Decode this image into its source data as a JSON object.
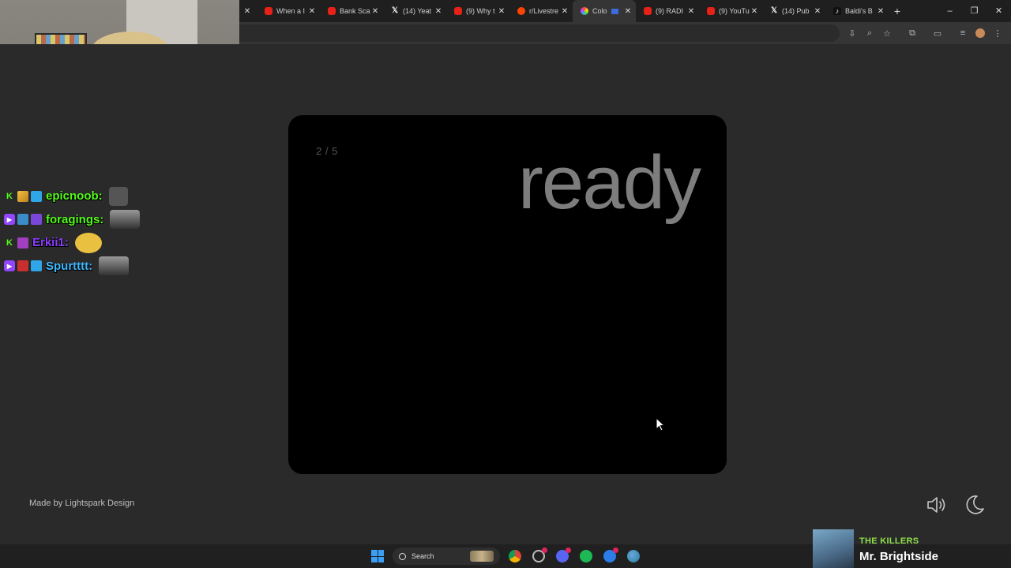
{
  "browser": {
    "tabs": [
      {
        "label": "",
        "icon": "generic-icon",
        "active": false
      },
      {
        "label": "When a I",
        "icon": "youtube-icon",
        "active": false
      },
      {
        "label": "Bank Sca",
        "icon": "youtube-icon",
        "active": false
      },
      {
        "label": "(14) Yeat",
        "icon": "x-icon",
        "active": false
      },
      {
        "label": "(9) Why t",
        "icon": "youtube-icon",
        "active": false
      },
      {
        "label": "r/Livestre",
        "icon": "reddit-icon",
        "active": false
      },
      {
        "label": "Colo",
        "icon": "color-wheel-icon",
        "active": true
      },
      {
        "label": "(9) RADI",
        "icon": "youtube-icon",
        "active": false
      },
      {
        "label": "(9) YouTu",
        "icon": "youtube-icon",
        "active": false
      },
      {
        "label": "(14) Pub",
        "icon": "x-icon",
        "active": false
      },
      {
        "label": "Baldi's B",
        "icon": "tiktok-icon",
        "active": false
      }
    ],
    "new_tab": "+",
    "window_controls": [
      "–",
      "❐",
      "✕"
    ]
  },
  "game": {
    "progress": "2 / 5",
    "prompt": "ready"
  },
  "footer": {
    "credit": "Made by Lightspark Design"
  },
  "taskbar": {
    "search_label": "Search"
  },
  "stream": {
    "chat": [
      {
        "user": "epicnoob:",
        "color": "#53fc18"
      },
      {
        "user": "foragings:",
        "color": "#53fc18"
      },
      {
        "user": "Erkii1:",
        "color": "#8a3cff"
      },
      {
        "user": "Spurtttt:",
        "color": "#3fb8ff"
      }
    ],
    "now_playing": {
      "artist": "THE KILLERS",
      "song": "Mr. Brightside"
    }
  },
  "colors": {
    "page_bg": "#2a2a2a",
    "card_bg": "#000000",
    "prompt_text": "#7d7d7d"
  }
}
